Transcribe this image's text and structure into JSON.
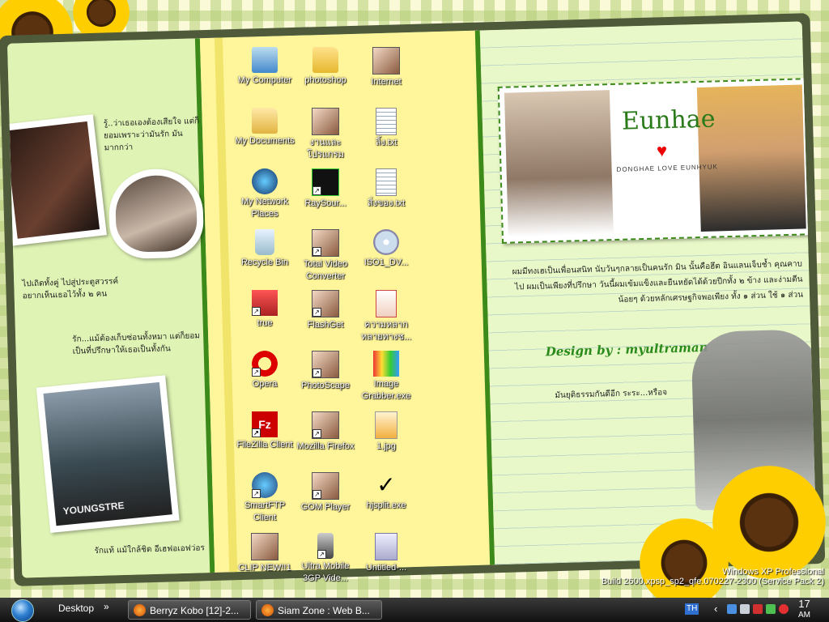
{
  "wallpaper": {
    "title": "Eunhae",
    "subtitle": "DONGHAE LOVE EUNHYUK",
    "design_credit": "Design by : myultraman",
    "photo_caption": "YOUNGSTRE",
    "thai_texts": [
      "รู้..ว่าเธอเองต้องเสียใจ แต่ก็ยอมเพราะว่ามันรัก มันมากกว่า",
      "ไปเถิดทั้งคู่ ไปสู่ประตูสวรรค์ อยากเห็นเธอไว้ทั้ง ๒ คน",
      "รัก...แม้ต้องเก็บซ่อนทั้งหมา แต่ก็ยอมเป็นที่ปรึกษาให้เธอเป็นทั้งกัน",
      "รักแท้ แม้ใกล้ชิด อีเฮฟอเอฟว่อร",
      "ผมมีทงเฮเป็นเพื่อนสนิท นับวันๆกลายเป็นคนรัก มิน นั้นคือฮึต อินแลนเจ็บช้ำ คุณคาบไป ผมเป็นเพียงที่ปรึกษา วันนี้ผมเข้มแข็งและยืนหยัดได้ด้วยปีกทั้ง ๒ ข้าง และง่ามตีนน้อยๆ ด้วยหลักเศรษฐกิจพอเพียง ทั้ง ๑ ส่วน ใช้ ๑ ส่วน",
      "มันยุติธรรมกันดีอีก ระระ...หรือจ"
    ]
  },
  "desktop_icons": [
    {
      "label": "My Computer",
      "glyph": "computer-icon",
      "shortcut": false
    },
    {
      "label": "photoshop",
      "glyph": "folder-icon",
      "shortcut": false
    },
    {
      "label": "Internet",
      "glyph": "photo-icon",
      "shortcut": false
    },
    {
      "label": "My Documents",
      "glyph": "documents-folder-icon",
      "shortcut": false
    },
    {
      "label": "งานและโปรแกรม",
      "glyph": "photo-icon",
      "shortcut": false
    },
    {
      "label": "ลิ้ง.txt",
      "glyph": "text-file-icon",
      "shortcut": false
    },
    {
      "label": "My Network Places",
      "glyph": "network-icon",
      "shortcut": false
    },
    {
      "label": "RaySour...",
      "glyph": "raysource-icon",
      "shortcut": true
    },
    {
      "label": "สิ่งของ.txt",
      "glyph": "text-file-icon",
      "shortcut": false
    },
    {
      "label": "Recycle Bin",
      "glyph": "recycle-bin-icon",
      "shortcut": false
    },
    {
      "label": "Total Video Converter",
      "glyph": "photo-icon",
      "shortcut": true
    },
    {
      "label": "ISO1_DV...",
      "glyph": "disc-icon",
      "shortcut": false
    },
    {
      "label": "true",
      "glyph": "network-app-icon",
      "shortcut": true
    },
    {
      "label": "FlashGet",
      "glyph": "photo-icon",
      "shortcut": true
    },
    {
      "label": "ความหลากหลายทางช...",
      "glyph": "powerpoint-icon",
      "shortcut": false
    },
    {
      "label": "Opera",
      "glyph": "opera-icon",
      "shortcut": true
    },
    {
      "label": "PhotoScape",
      "glyph": "photo-icon",
      "shortcut": true
    },
    {
      "label": "Image Grabber.exe",
      "glyph": "image-grabber-icon",
      "shortcut": false
    },
    {
      "label": "FileZilla Client",
      "glyph": "filezilla-icon",
      "shortcut": true
    },
    {
      "label": "Mozilla Firefox",
      "glyph": "photo-icon",
      "shortcut": true
    },
    {
      "label": "1.jpg",
      "glyph": "image-file-icon",
      "shortcut": false
    },
    {
      "label": "SmartFTP Client",
      "glyph": "smartftp-icon",
      "shortcut": true
    },
    {
      "label": "GOM Player",
      "glyph": "photo-icon",
      "shortcut": true
    },
    {
      "label": "hjsplit.exe",
      "glyph": "checkmark-icon",
      "shortcut": false
    },
    {
      "label": "CLIP NEW!!1",
      "glyph": "photo-icon",
      "shortcut": false
    },
    {
      "label": "Ultra Mobile 3GP Vide...",
      "glyph": "mobile-video-icon",
      "shortcut": true
    },
    {
      "label": "Untitled-...",
      "glyph": "psd-file-icon",
      "shortcut": false
    }
  ],
  "watermark": {
    "line1": "Windows XP Professional",
    "line2": "Build 2600.xpsp_sp2_qfe.070227-2300 (Service Pack 2)"
  },
  "taskbar": {
    "desktop_label": "Desktop",
    "chevron": "»",
    "buttons": [
      {
        "label": "Berryz Kobo [12]-2..."
      },
      {
        "label": "Siam Zone : Web B..."
      }
    ],
    "language": "TH",
    "clock_time": "17",
    "clock_ampm": "AM"
  },
  "colors": {
    "accent": "#3c8a1a",
    "taskbar": "#1a1a1a",
    "highlight": "#fff59a"
  }
}
